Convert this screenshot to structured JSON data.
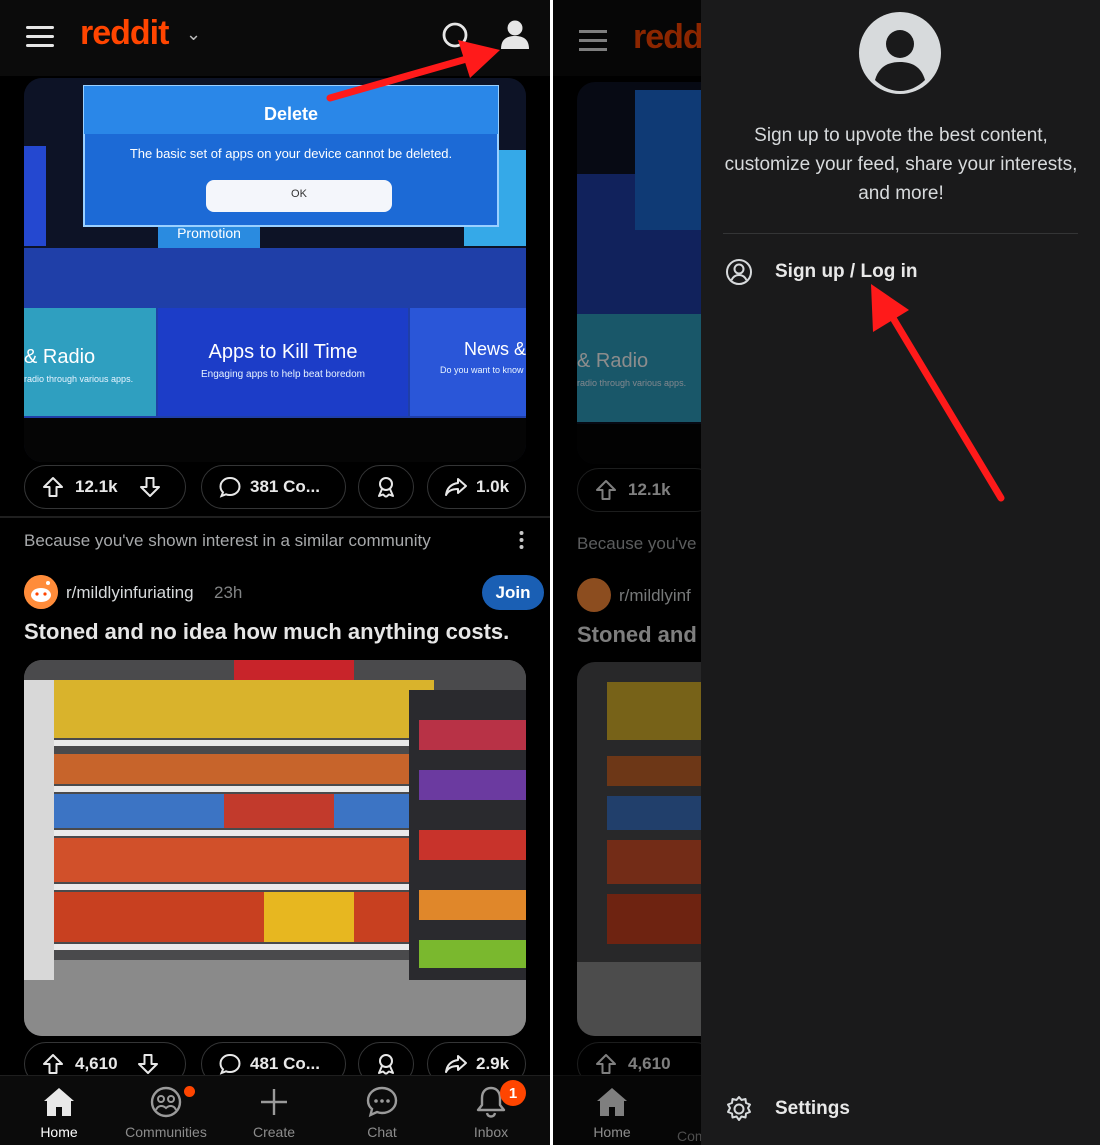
{
  "header": {
    "logo_text": "reddit",
    "chevron": "⌄"
  },
  "post1": {
    "image": {
      "dialog_title": "Delete",
      "dialog_message": "The basic set of apps on your device cannot be deleted.",
      "dialog_ok": "OK",
      "promo_label": "Promotion",
      "tile_radio_title": "& Radio",
      "tile_radio_sub": "radio through various apps.",
      "tile_apps_title": "Apps to Kill Time",
      "tile_apps_sub": "Engaging apps to help beat boredom",
      "tile_news_title": "News &",
      "tile_news_sub": "Do you want to know to"
    },
    "upvotes": "12.1k",
    "comments": "381 Co...",
    "shares": "1.0k"
  },
  "recommendation": "Because you've shown interest in a similar community",
  "post2": {
    "subreddit": "r/mildlyinfuriating",
    "time": "23h",
    "join_label": "Join",
    "title": "Stoned and no idea how much anything costs.",
    "upvotes": "4,610",
    "comments": "481 Co...",
    "shares": "2.9k"
  },
  "bottom_nav": {
    "home": "Home",
    "communities": "Communities",
    "create": "Create",
    "chat": "Chat",
    "inbox": "Inbox",
    "inbox_badge": "1"
  },
  "right_bg": {
    "recommendation_partial": "Because you've s",
    "subreddit_partial": "r/mildlyinf",
    "title_partial": "Stoned and r",
    "home": "Home",
    "communities_partial": "Com"
  },
  "drawer": {
    "prompt": "Sign up to upvote the best content, customize your feed, share your interests, and more!",
    "signup_login": "Sign up / Log in",
    "settings": "Settings"
  },
  "colors": {
    "brand": "#ff4500",
    "arrow": "#ff1a1a",
    "join": "#1a5fb4",
    "background": "#000000",
    "drawer": "#1a1a1b"
  }
}
